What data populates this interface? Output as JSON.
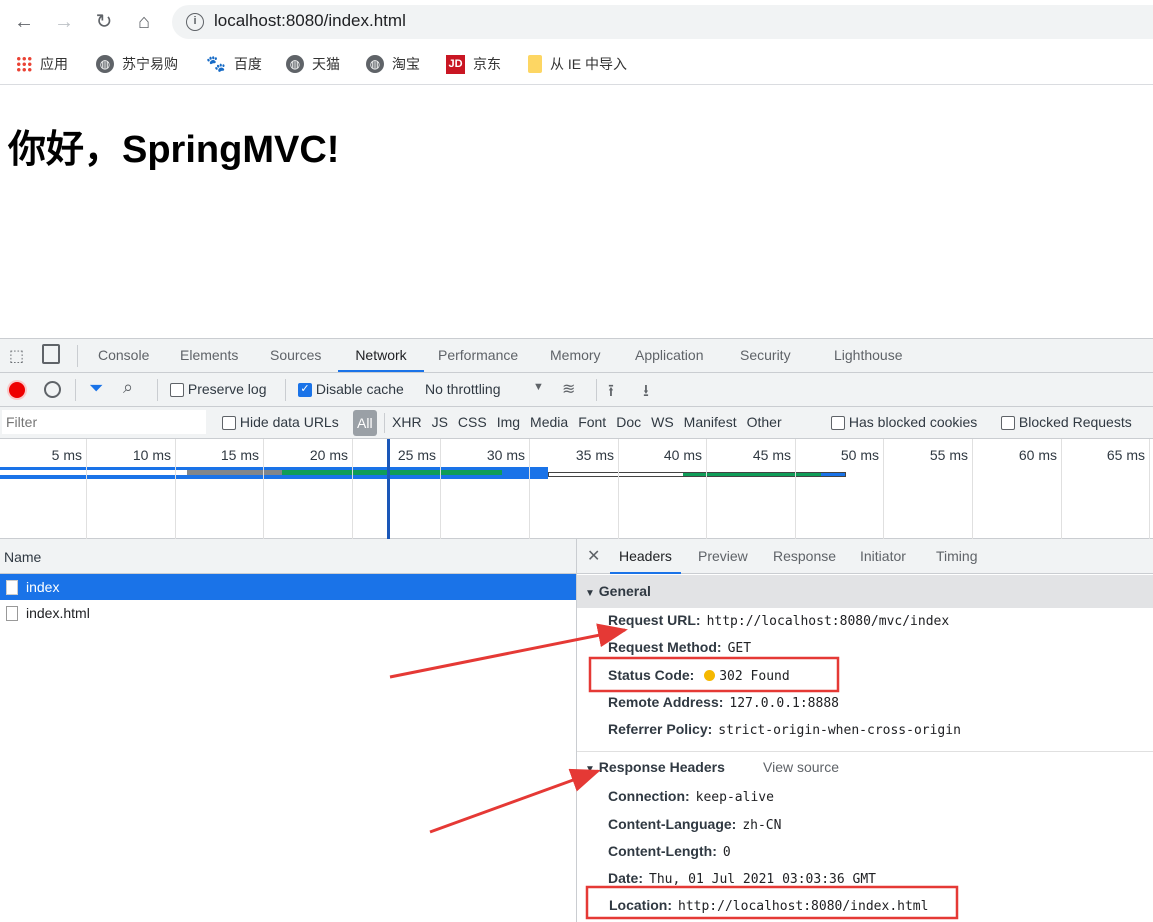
{
  "browser": {
    "url": "localhost:8080/index.html",
    "bookmarks": [
      {
        "label": "应用",
        "icon": "apps-grid-icon"
      },
      {
        "label": "苏宁易购",
        "icon": "globe-icon"
      },
      {
        "label": "百度",
        "icon": "baidu-paw-icon"
      },
      {
        "label": "天猫",
        "icon": "globe-icon"
      },
      {
        "label": "淘宝",
        "icon": "globe-icon"
      },
      {
        "label": "京东",
        "icon": "jd-logo-icon",
        "logo_text": "JD"
      },
      {
        "label": "从 IE 中导入",
        "icon": "folder-icon"
      }
    ]
  },
  "page": {
    "heading": "你好，SpringMVC!"
  },
  "devtools": {
    "tabs": [
      "Console",
      "Elements",
      "Sources",
      "Network",
      "Performance",
      "Memory",
      "Application",
      "Security",
      "Lighthouse"
    ],
    "active_tab": "Network",
    "toolbar": {
      "preserve_log": "Preserve log",
      "preserve_log_checked": false,
      "disable_cache": "Disable cache",
      "disable_cache_checked": true,
      "throttling": "No throttling"
    },
    "filter": {
      "placeholder": "Filter",
      "hide_data_urls": "Hide data URLs",
      "types": [
        "All",
        "XHR",
        "JS",
        "CSS",
        "Img",
        "Media",
        "Font",
        "Doc",
        "WS",
        "Manifest",
        "Other"
      ],
      "has_blocked_cookies": "Has blocked cookies",
      "blocked_requests": "Blocked Requests"
    },
    "timeline_ticks": [
      "5 ms",
      "10 ms",
      "15 ms",
      "20 ms",
      "25 ms",
      "30 ms",
      "35 ms",
      "40 ms",
      "45 ms",
      "50 ms",
      "55 ms",
      "60 ms",
      "65 ms"
    ],
    "requests": {
      "header": "Name",
      "items": [
        {
          "name": "index",
          "selected": true
        },
        {
          "name": "index.html",
          "selected": false
        }
      ]
    },
    "detail": {
      "tabs": [
        "Headers",
        "Preview",
        "Response",
        "Initiator",
        "Timing"
      ],
      "active": "Headers",
      "general_title": "General",
      "general": [
        {
          "k": "Request URL:",
          "v": "http://localhost:8080/mvc/index"
        },
        {
          "k": "Request Method:",
          "v": "GET"
        },
        {
          "k": "Status Code:",
          "v": "302 Found"
        },
        {
          "k": "Remote Address:",
          "v": "127.0.0.1:8888"
        },
        {
          "k": "Referrer Policy:",
          "v": "strict-origin-when-cross-origin"
        }
      ],
      "response_title": "Response Headers",
      "view_source": "View source",
      "response": [
        {
          "k": "Connection:",
          "v": "keep-alive"
        },
        {
          "k": "Content-Language:",
          "v": "zh-CN"
        },
        {
          "k": "Content-Length:",
          "v": "0"
        },
        {
          "k": "Date:",
          "v": "Thu, 01 Jul 2021 03:03:36 GMT"
        },
        {
          "k": "Location:",
          "v": "http://localhost:8080/index.html"
        }
      ]
    }
  },
  "colors": {
    "accent": "#1a73e8",
    "annotation": "#e53935",
    "status_dot": "#f5b800"
  }
}
